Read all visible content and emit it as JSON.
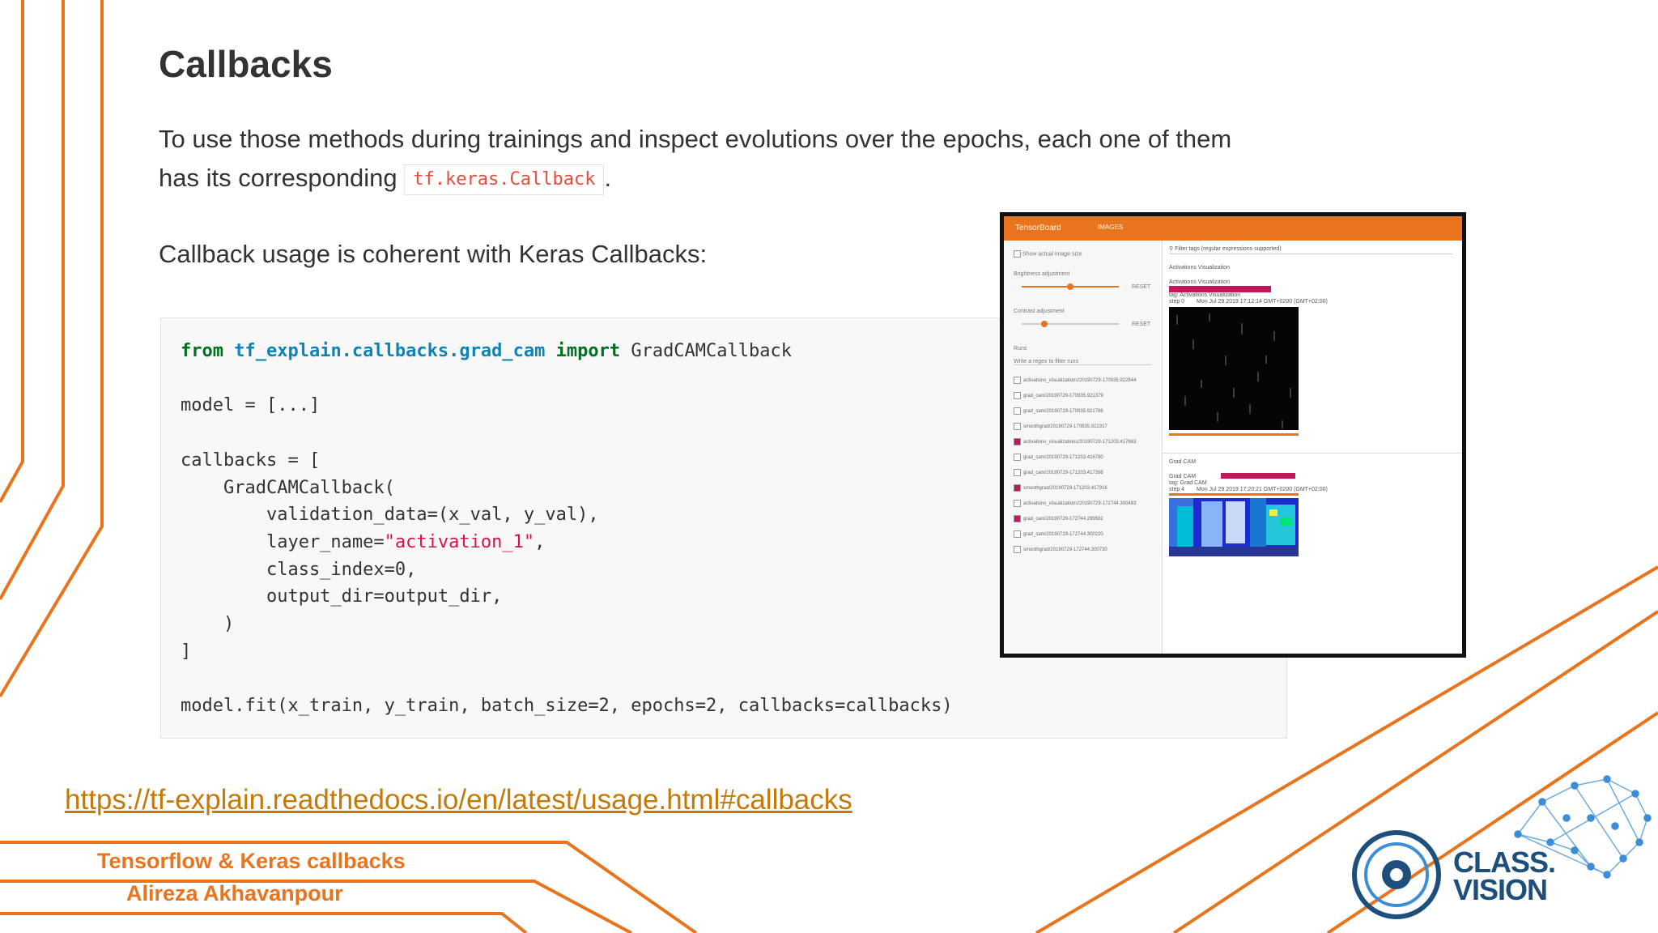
{
  "slide": {
    "title": "Callbacks",
    "paragraph1_line1": "To use those methods during trainings and inspect evolutions over the epochs, each one of them",
    "paragraph1_line2_prefix": "has its corresponding",
    "inline_code": "tf.keras.Callback",
    "paragraph1_suffix": ".",
    "paragraph2": "Callback usage is coherent with Keras Callbacks:",
    "link": "https://tf-explain.readthedocs.io/en/latest/usage.html#callbacks",
    "footer_title": "Tensorflow & Keras callbacks",
    "footer_author": "Alireza Akhavanpour",
    "brand_line1": "CLASS.",
    "brand_line2": "VISION"
  },
  "code": {
    "kw_from": "from",
    "module": "tf_explain.callbacks.grad_cam",
    "kw_import": "import",
    "import_name": "GradCAMCallback",
    "line_model": "model = [...]",
    "line_callbacks": "callbacks = [",
    "line_ctor": "    GradCAMCallback(",
    "line_val": "        validation_data=(x_val, y_val),",
    "line_layer_prefix": "        layer_name=",
    "line_layer_str": "\"activation_1\"",
    "line_layer_suffix": ",",
    "line_class": "        class_index=0,",
    "line_output": "        output_dir=output_dir,",
    "line_close_paren": "    )",
    "line_close_bracket": "]",
    "line_fit": "model.fit(x_train, y_train, batch_size=2, epochs=2, callbacks=callbacks)"
  },
  "tensorboard": {
    "title": "TensorBoard",
    "tab": "IMAGES",
    "show_size": "Show actual image size",
    "brightness": "Brightness adjustment",
    "contrast": "Contrast adjustment",
    "reset": "RESET",
    "runs": "Runs",
    "runs_filter": "Write a regex to filter runs",
    "filter_tags": "Filter tags (regular expressions supported)",
    "section1": "Activations Visualization",
    "card1_title": "Activations Visualization",
    "card1_tag": "tag: Activations Visualization",
    "card1_step": "step 0",
    "card1_date": "Mon Jul 29 2019 17:12:14 GMT+0200 (GMT+02:00)",
    "section2": "Grad CAM",
    "card2_title": "Grad CAM",
    "card2_tag": "tag: Grad CAM",
    "card2_step": "step 4",
    "card2_date": "Mon Jul 29 2019 17:20:21 GMT+0200 (GMT+02:00)",
    "runs_list": [
      {
        "label": "activations_visualizations/20190729-170935.922844",
        "checked": false
      },
      {
        "label": "grad_cam/20190729-170935.921379",
        "checked": false
      },
      {
        "label": "grad_cam/20190729-170935.921786",
        "checked": false
      },
      {
        "label": "smoothgrad/20190729-170935.922317",
        "checked": false
      },
      {
        "label": "activations_visualizations/20190729-171203.417663",
        "checked": true
      },
      {
        "label": "grad_cam/20190729-171203.416780",
        "checked": false
      },
      {
        "label": "grad_cam/20190729-171203.417396",
        "checked": false
      },
      {
        "label": "smoothgrad/20190729-171203.417916",
        "checked": true
      },
      {
        "label": "activations_visualizations/20190729-172744.300483",
        "checked": false
      },
      {
        "label": "grad_cam/20190729-172744.299582",
        "checked": true
      },
      {
        "label": "grad_cam/20190729-172744.300220",
        "checked": false
      },
      {
        "label": "smoothgrad/20190729-172744.300730",
        "checked": false
      }
    ]
  },
  "colors": {
    "accent_orange": "#e8741d",
    "brand_blue": "#1d4f7c",
    "link": "#c47a0a"
  }
}
